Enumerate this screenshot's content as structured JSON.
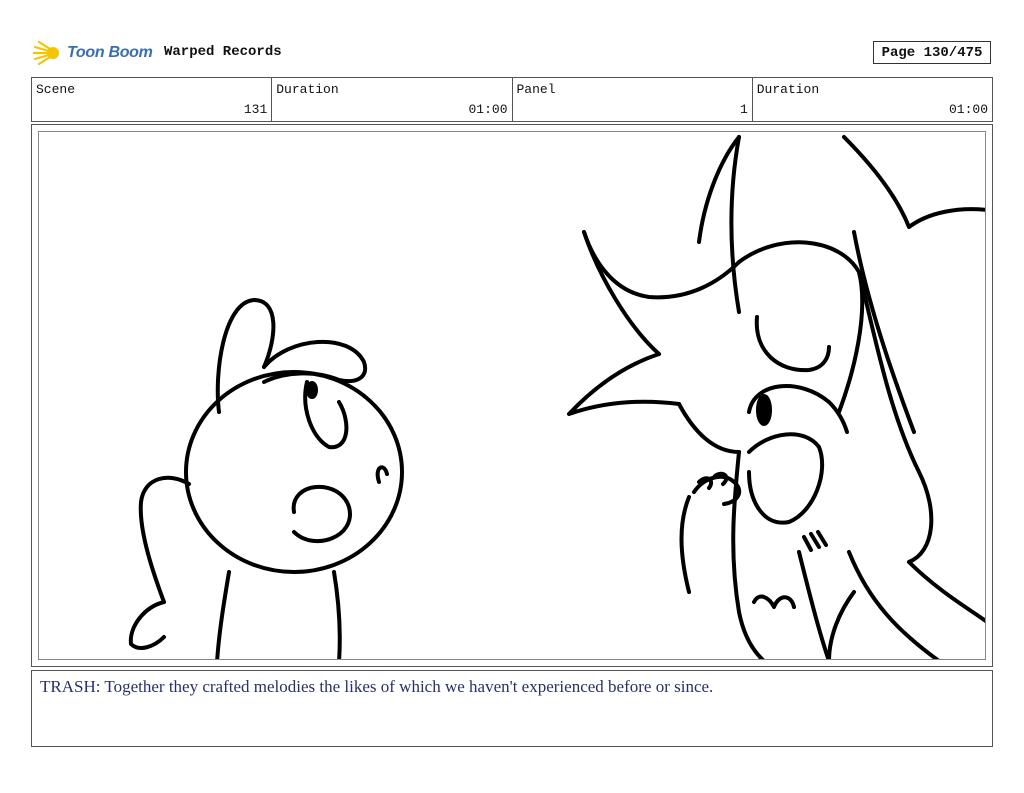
{
  "header": {
    "logo_text": "Toon Boom",
    "project_title": "Warped Records",
    "page_label": "Page 130/475"
  },
  "info": {
    "scene_label": "Scene",
    "scene_value": "131",
    "duration_label": "Duration",
    "duration_value": "01:00",
    "panel_label": "Panel",
    "panel_value": "1",
    "panel_duration_label": "Duration",
    "panel_duration_value": "01:00"
  },
  "panel": {
    "image_icon": "storyboard-sketch",
    "accent_color": "#f5c400"
  },
  "caption": {
    "text": "TRASH: Together they crafted melodies the likes of which we haven't experienced before or since."
  }
}
